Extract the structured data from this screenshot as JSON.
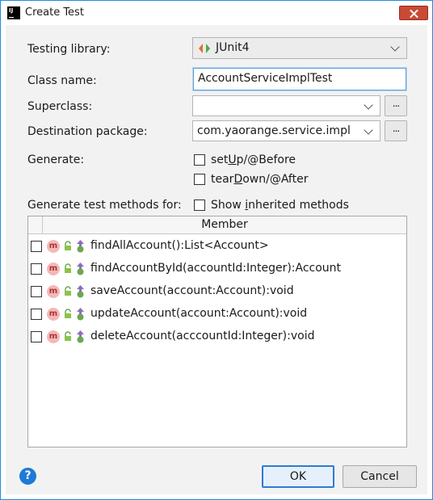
{
  "window": {
    "title": "Create Test",
    "app_icon_text": "IJ"
  },
  "labels": {
    "testing_library": "Testing library:",
    "class_name": "Class name:",
    "superclass": "Superclass:",
    "destination_package": "Destination package:",
    "generate": "Generate:",
    "generate_test_methods_for": "Generate test methods for:"
  },
  "fields": {
    "testing_library_value": "JUnit4",
    "class_name_value": "AccountServiceImplTest",
    "superclass_value": "",
    "destination_package_value": "com.yaorange.service.impl",
    "browse_label": "..."
  },
  "generate_options": [
    {
      "label_pre": "set",
      "mnemonic": "U",
      "label_post": "p/@Before",
      "checked": false
    },
    {
      "label_pre": "tear",
      "mnemonic": "D",
      "label_post": "own/@After",
      "checked": false
    }
  ],
  "show_inherited": {
    "label_pre": "Show ",
    "mnemonic": "i",
    "label_post": "nherited methods",
    "checked": false
  },
  "table": {
    "header": "Member",
    "rows": [
      {
        "text": "findAllAccount():List<Account>",
        "checked": false,
        "icon": "method-icon"
      },
      {
        "text": "findAccountById(accountId:Integer):Account",
        "checked": false,
        "icon": "method-icon"
      },
      {
        "text": "saveAccount(account:Account):void",
        "checked": false,
        "icon": "method-icon"
      },
      {
        "text": "updateAccount(account:Account):void",
        "checked": false,
        "icon": "method-icon"
      },
      {
        "text": "deleteAccount(acccountId:Integer):void",
        "checked": false,
        "icon": "method-icon"
      }
    ],
    "method_icon_letter": "m"
  },
  "buttons": {
    "ok": "OK",
    "cancel": "Cancel",
    "help": "?"
  },
  "colors": {
    "accent": "#2d7bd6",
    "close": "#c94a35",
    "method_badge": "#f3b8b8"
  }
}
